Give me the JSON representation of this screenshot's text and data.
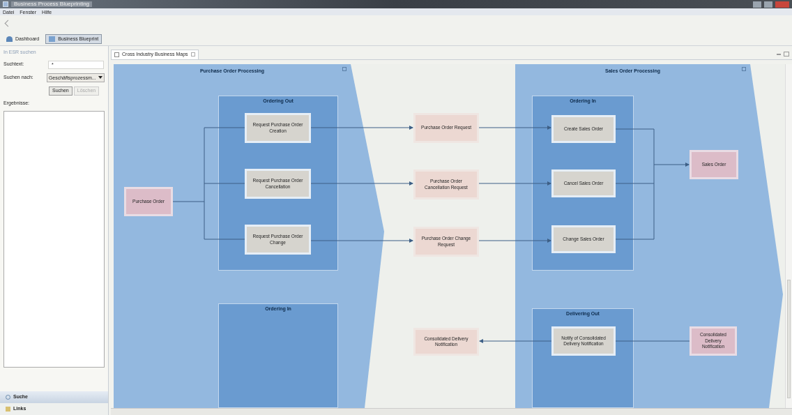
{
  "window": {
    "title": "Business Process Blueprinting"
  },
  "menu": [
    "Datei",
    "Fenster",
    "Hilfe"
  ],
  "perspectives": [
    {
      "label": "Dashboard",
      "selected": false
    },
    {
      "label": "Business Blueprint",
      "selected": true
    }
  ],
  "search_panel": {
    "title": "In ESR suchen",
    "search_label": "Suchtext:",
    "search_value": "*",
    "type_label": "Suchen nach:",
    "type_value": "Geschäftsprozessm...",
    "search_button": "Suchen",
    "clear_button": {
      "label": "Löschen",
      "disabled": true
    },
    "results_label": "Ergebnisse:"
  },
  "bottom_views": [
    {
      "label": "Suche",
      "selected": true
    },
    {
      "label": "Links",
      "selected": false
    }
  ],
  "editor_tab": {
    "label": "Cross Industry Business Maps"
  },
  "pools": [
    {
      "title": "Purchase Order Processing",
      "lanes": [
        "Ordering Out",
        "Ordering In"
      ]
    },
    {
      "title": "Sales Order Processing",
      "lanes": [
        "Ordering In",
        "Delivering Out"
      ]
    }
  ],
  "nodes": [
    {
      "label": "Purchase Order",
      "kind": "business_object"
    },
    {
      "label": "Request Purchase Order Creation",
      "kind": "step"
    },
    {
      "label": "Request Purchase Order Cancellation",
      "kind": "step"
    },
    {
      "label": "Request Purchase Order Change",
      "kind": "step"
    },
    {
      "label": "Purchase Order Request",
      "kind": "message"
    },
    {
      "label": "Purchase Order Cancellation Request",
      "kind": "message"
    },
    {
      "label": "Purchase Order Change Request",
      "kind": "message"
    },
    {
      "label": "Create Sales Order",
      "kind": "step"
    },
    {
      "label": "Cancel Sales Order",
      "kind": "step"
    },
    {
      "label": "Change Sales Order",
      "kind": "step"
    },
    {
      "label": "Sales Order",
      "kind": "business_object"
    },
    {
      "label": "Consolidated Delivery Notification",
      "kind": "message"
    },
    {
      "label": "Notify of Consolidated Delivery Notification",
      "kind": "step"
    },
    {
      "label": "Consolidated Delivery Notification",
      "kind": "business_object"
    }
  ]
}
